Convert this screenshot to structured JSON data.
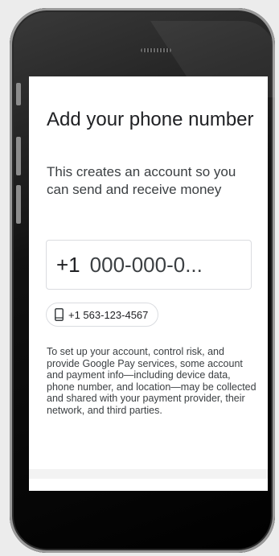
{
  "screen": {
    "title": "Add your phone number",
    "subtitle": "This creates an account so you can send and receive money",
    "phone_input": {
      "country_code": "+1",
      "placeholder": "000-000-0..."
    },
    "suggestion_chip": {
      "icon": "smartphone-icon",
      "number": "+1 563-123-4567"
    },
    "disclaimer": "To set up your account, control risk, and provide Google Pay services, some account and payment info—including device data, phone number, and location—may be collected and shared with your payment provider, their network, and third parties."
  },
  "colors": {
    "text_primary": "#202124",
    "text_secondary": "#3c4043",
    "border": "#dadce0",
    "phone_body": "#111111"
  }
}
